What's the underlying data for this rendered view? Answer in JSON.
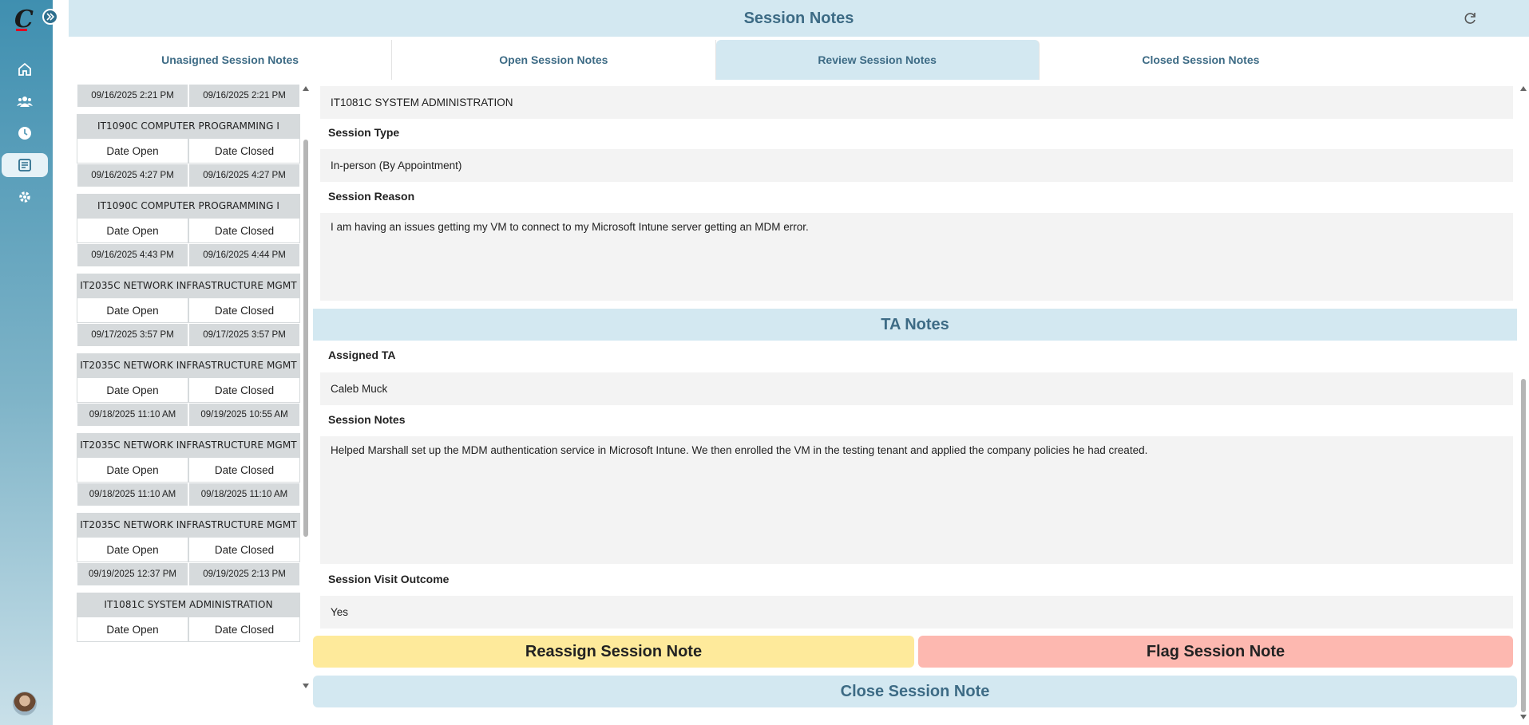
{
  "app": {
    "header_title": "Session Notes",
    "logo_letter": "C",
    "accent": "#3d6b85",
    "sidebar_icons": [
      "home-icon",
      "users-icon",
      "clock-icon",
      "notes-icon",
      "gear-icon"
    ]
  },
  "tabs": [
    {
      "label": "Unasigned Session Notes",
      "active": false
    },
    {
      "label": "Open Session Notes",
      "active": false
    },
    {
      "label": "Review Session Notes",
      "active": true
    },
    {
      "label": "Closed Session Notes",
      "active": false
    }
  ],
  "list": {
    "col_open": "Date Open",
    "col_closed": "Date Closed",
    "partial_top": {
      "open": "09/16/2025 2:21 PM",
      "closed": "09/16/2025 2:21 PM"
    },
    "items": [
      {
        "course": "IT1090C COMPUTER PROGRAMMING I",
        "open": "09/16/2025 4:27 PM",
        "closed": "09/16/2025 4:27 PM"
      },
      {
        "course": "IT1090C COMPUTER PROGRAMMING I",
        "open": "09/16/2025 4:43 PM",
        "closed": "09/16/2025 4:44 PM"
      },
      {
        "course": "IT2035C NETWORK INFRASTRUCTURE MGMT",
        "open": "09/17/2025 3:57 PM",
        "closed": "09/17/2025 3:57 PM"
      },
      {
        "course": "IT2035C NETWORK INFRASTRUCTURE MGMT",
        "open": "09/18/2025 11:10 AM",
        "closed": "09/19/2025 10:55 AM"
      },
      {
        "course": "IT2035C NETWORK INFRASTRUCTURE MGMT",
        "open": "09/18/2025 11:10 AM",
        "closed": "09/18/2025 11:10 AM"
      },
      {
        "course": "IT2035C NETWORK INFRASTRUCTURE MGMT",
        "open": "09/19/2025 12:37 PM",
        "closed": "09/19/2025 2:13 PM"
      },
      {
        "course": "IT1081C SYSTEM ADMINISTRATION",
        "open": "",
        "closed": ""
      }
    ]
  },
  "detail": {
    "course_value": "IT1081C SYSTEM ADMINISTRATION",
    "session_type_label": "Session Type",
    "session_type_value": "In-person (By Appointment)",
    "session_reason_label": "Session Reason",
    "session_reason_value": "I am having an issues getting my VM to connect to my Microsoft Intune server getting an MDM error.",
    "ta_notes_heading": "TA Notes",
    "assigned_ta_label": "Assigned TA",
    "assigned_ta_value": "Caleb Muck",
    "session_notes_label": "Session Notes",
    "session_notes_value": "Helped Marshall set up the MDM authentication service in Microsoft Intune. We then enrolled the VM in the testing tenant and applied the company policies he had created.",
    "outcome_label": "Session Visit Outcome",
    "outcome_value": "Yes"
  },
  "actions": {
    "reassign": "Reassign Session Note",
    "flag": "Flag Session Note",
    "close": "Close Session Note"
  }
}
